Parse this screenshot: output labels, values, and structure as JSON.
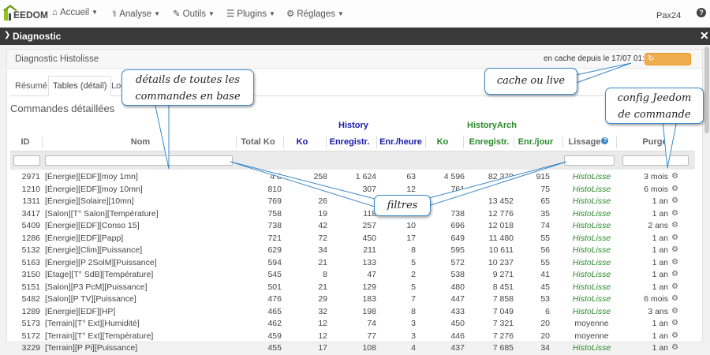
{
  "nav": {
    "logo_text": "EEDOM",
    "items": [
      {
        "icon": "home-icon",
        "label": "Accueil"
      },
      {
        "icon": "analysis-icon",
        "label": "Analyse"
      },
      {
        "icon": "wrench-icon",
        "label": "Outils"
      },
      {
        "icon": "list-icon",
        "label": "Plugins"
      },
      {
        "icon": "gear-icon",
        "label": "Réglages"
      }
    ],
    "user": "Pax24"
  },
  "modal": {
    "title": "Diagnostic"
  },
  "panel": {
    "title": "Diagnostic Histolisse",
    "cache_text": "en cache depuis le 17/07 01:47",
    "refresh_label": "Rafraîchir"
  },
  "tabs": [
    "Résumé",
    "Tables (détail)",
    "Log"
  ],
  "section_title": "Commandes détaillées",
  "groups": {
    "history": "History",
    "historyarch": "HistoryArch"
  },
  "columns": [
    "ID",
    "Nom",
    "Total Ko",
    "Ko",
    "Enregistr.",
    "Enr./heure",
    "Ko",
    "Enregistr.",
    "Enr./jour",
    "Lissage",
    "Purge"
  ],
  "rows": [
    [
      "2971",
      "[Énergie][EDF][moy 1mn]",
      "4 8",
      "258",
      "1 624",
      "63",
      "4 596",
      "82 379",
      "915",
      "HistoLisse",
      "3 mois"
    ],
    [
      "1210",
      "[Énergie][EDF][moy 10mn]",
      "810",
      "",
      "307",
      "12",
      "761",
      "",
      "75",
      "HistoLisse",
      "6 mois"
    ],
    [
      "1311",
      "[Énergie][Solaire][10mn]",
      "769",
      "26",
      "",
      "",
      "",
      "13 452",
      "65",
      "HistoLisse",
      "1 an"
    ],
    [
      "3417",
      "[Salon][T° Salon][Température]",
      "758",
      "19",
      "118",
      "",
      "738",
      "12 776",
      "35",
      "HistoLisse",
      "1 an"
    ],
    [
      "5409",
      "[Énergie][EDF][Conso 15]",
      "738",
      "42",
      "257",
      "10",
      "696",
      "12 018",
      "74",
      "HistoLisse",
      "2 ans"
    ],
    [
      "1286",
      "[Énergie][EDF][Papp]",
      "721",
      "72",
      "450",
      "17",
      "649",
      "11 480",
      "55",
      "HistoLisse",
      "1 an"
    ],
    [
      "5132",
      "[Énergie][Clim][Puissance]",
      "629",
      "34",
      "211",
      "8",
      "595",
      "10 611",
      "56",
      "HistoLisse",
      "1 an"
    ],
    [
      "5163",
      "[Énergie][P 2SolM][Puissance]",
      "594",
      "21",
      "133",
      "5",
      "572",
      "10 237",
      "55",
      "HistoLisse",
      "1 an"
    ],
    [
      "3150",
      "[Étage][T° SdB][Température]",
      "545",
      "8",
      "47",
      "2",
      "538",
      "9 271",
      "41",
      "HistoLisse",
      "1 an"
    ],
    [
      "5151",
      "[Salon][P3 PcM][Puissance]",
      "501",
      "21",
      "129",
      "5",
      "480",
      "8 451",
      "45",
      "HistoLisse",
      "1 an"
    ],
    [
      "5482",
      "[Salon][P TV][Puissance]",
      "476",
      "29",
      "183",
      "7",
      "447",
      "7 858",
      "53",
      "HistoLisse",
      "6 mois"
    ],
    [
      "1289",
      "[Énergie][EDF][HP]",
      "465",
      "32",
      "198",
      "8",
      "433",
      "7 049",
      "6",
      "HistoLisse",
      "3 ans"
    ],
    [
      "5173",
      "[Terrain][T° Ext][Humidité]",
      "462",
      "12",
      "74",
      "3",
      "450",
      "7 321",
      "20",
      "moyenne",
      "1 an"
    ],
    [
      "5172",
      "[Terrain][T° Ext][Température]",
      "459",
      "12",
      "77",
      "3",
      "446",
      "7 276",
      "20",
      "moyenne",
      "1 an"
    ],
    [
      "3229",
      "[Terrain][P Pi][Puissance]",
      "455",
      "17",
      "108",
      "4",
      "437",
      "7 685",
      "34",
      "HistoLisse",
      "1 an"
    ]
  ],
  "annotations": {
    "details": [
      "détails de toutes les",
      "commandes en base"
    ],
    "cache": "cache ou live",
    "config": [
      "config Jeedom",
      "de commande"
    ],
    "filters": "filtres"
  },
  "colors": {
    "navbar": "#fdfdfd",
    "modal_bar": "#393939",
    "refresh": "#f0ad4e",
    "history": "#1a1aa8",
    "historyarch": "#2a8a2a",
    "callout_border": "#3a88c8"
  }
}
